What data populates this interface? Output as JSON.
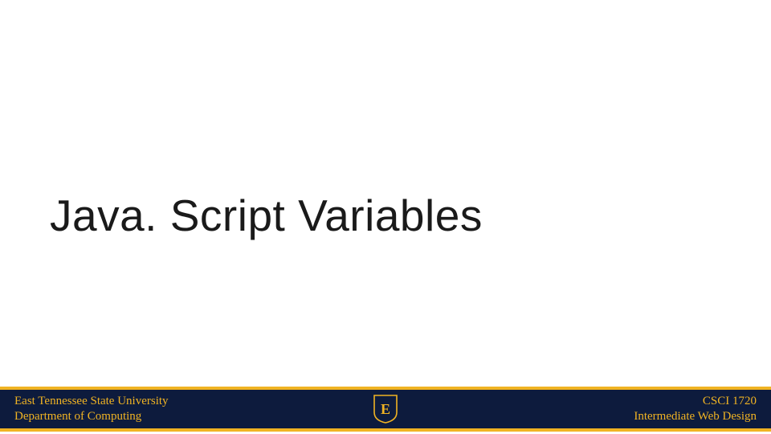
{
  "slide": {
    "title": "Java. Script Variables"
  },
  "footer": {
    "left_line1": "East Tennessee State University",
    "left_line2": "Department of Computing",
    "right_line1": "CSCI 1720",
    "right_line2": "Intermediate Web Design",
    "logo_letter": "E",
    "colors": {
      "band": "#0d1b3d",
      "accent": "#f0b323"
    }
  }
}
